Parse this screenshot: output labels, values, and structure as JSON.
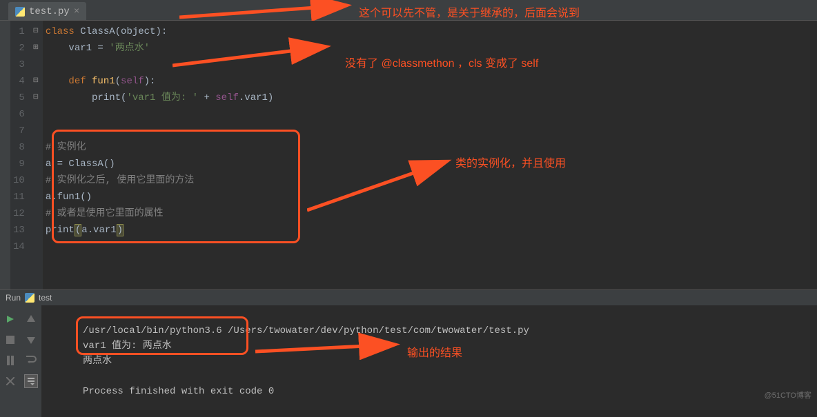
{
  "tab": {
    "filename": "test.py"
  },
  "lineNumbers": [
    "1",
    "2",
    "3",
    "4",
    "5",
    "6",
    "7",
    "8",
    "9",
    "10",
    "11",
    "12",
    "13",
    "14"
  ],
  "code": {
    "l1a": "class ",
    "l1b": "ClassA(object):",
    "l2a": "    var1 = ",
    "l2b": "'两点水'",
    "l4a": "    def ",
    "l4b": "fun1",
    "l4c": "(",
    "l4d": "self",
    "l4e": "):",
    "l5a": "        print(",
    "l5b": "'var1 值为: '",
    "l5c": " + ",
    "l5d": "self",
    "l5e": ".var1)",
    "l8": "# 实例化",
    "l9": "a = ClassA()",
    "l10": "# 实例化之后, 使用它里面的方法",
    "l11": "a.fun1()",
    "l12": "# 或者是使用它里面的属性",
    "l13a": "print",
    "l13b": "(",
    "l13c": "a.var1",
    "l13d": ")"
  },
  "annotations": {
    "a1": "这个可以先不管，是关于继承的，后面会说到",
    "a2": "没有了 @classmethon ，cls 变成了 self",
    "a3": "类的实例化，并且使用",
    "a4": "输出的结果"
  },
  "run": {
    "label": "Run",
    "config": "test",
    "path": "/usr/local/bin/python3.6 /Users/twowater/dev/python/test/com/twowater/test.py",
    "out1": "var1 值为: 两点水",
    "out2": "两点水",
    "exit": "Process finished with exit code 0"
  },
  "watermark": "@51CTO博客"
}
